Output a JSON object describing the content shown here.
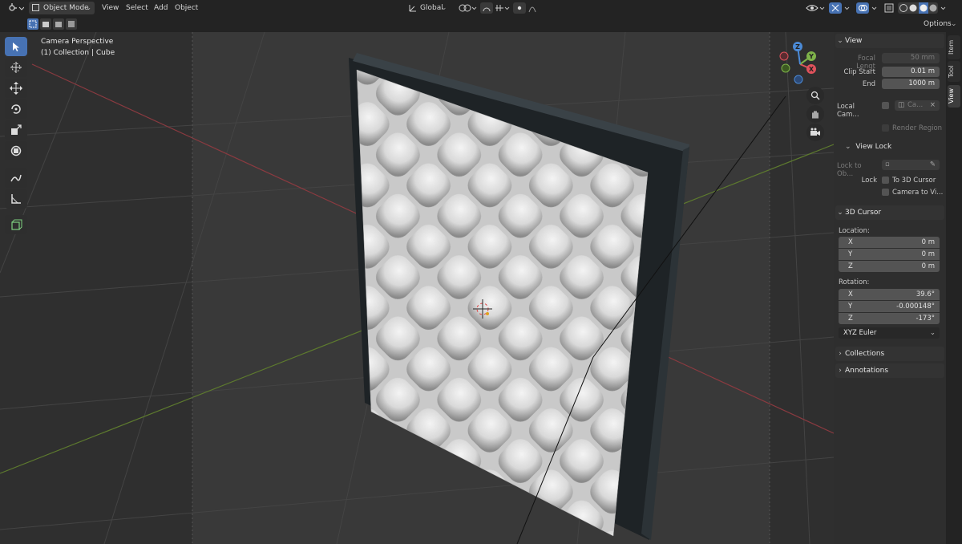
{
  "header": {
    "mode": "Object Mode",
    "menu": [
      "View",
      "Select",
      "Add",
      "Object"
    ],
    "transform_orientation": "Global",
    "options": "Options"
  },
  "viewport": {
    "perspective": "Camera Perspective",
    "collection": "(1) Collection | Cube"
  },
  "gizmo": {
    "x": "X",
    "y": "Y",
    "z": "Z"
  },
  "tabs": [
    "Item",
    "Tool",
    "View"
  ],
  "panel": {
    "view_title": "View",
    "focal_length_label": "Focal Lengt",
    "focal_length": "50 mm",
    "clip_start_label": "Clip Start",
    "clip_start": "0.01 m",
    "clip_end_label": "End",
    "clip_end": "1000 m",
    "local_camera_label": "Local Cam...",
    "local_camera_value": "Ca...",
    "render_region": "Render Region",
    "view_lock_title": "View Lock",
    "lock_to_object_label": "Lock to Ob...",
    "lock_label": "Lock",
    "to_3d_cursor": "To 3D Cursor",
    "camera_to_view": "Camera to Vi...",
    "cursor_title": "3D Cursor",
    "location_label": "Location:",
    "location": [
      {
        "axis": "X",
        "value": "0 m"
      },
      {
        "axis": "Y",
        "value": "0 m"
      },
      {
        "axis": "Z",
        "value": "0 m"
      }
    ],
    "rotation_label": "Rotation:",
    "rotation": [
      {
        "axis": "X",
        "value": "39.6°"
      },
      {
        "axis": "Y",
        "value": "-0.000148°"
      },
      {
        "axis": "Z",
        "value": "-173°"
      }
    ],
    "rotation_mode": "XYZ Euler",
    "collections_title": "Collections",
    "annotations_title": "Annotations"
  },
  "colors": {
    "accent": "#4772b3",
    "x_axis": "#e0525c",
    "y_axis": "#7fb34a",
    "z_axis": "#4b8ad6"
  }
}
